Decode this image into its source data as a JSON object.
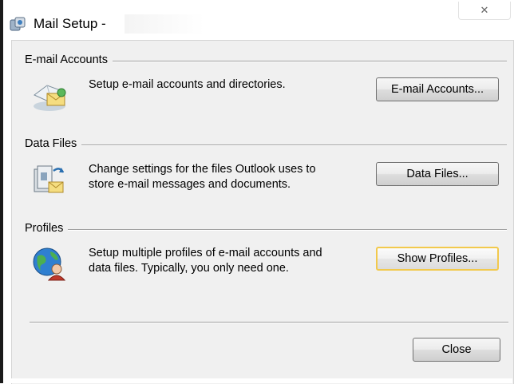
{
  "window": {
    "title": "Mail Setup -",
    "close_glyph": "✕"
  },
  "groups": {
    "email_accounts": {
      "title": "E-mail Accounts",
      "description": "Setup e-mail accounts and directories.",
      "button_label": "E-mail Accounts...",
      "icon": "mail-envelope-icon"
    },
    "data_files": {
      "title": "Data Files",
      "description_line1": "Change settings for the files Outlook uses to",
      "description_line2": "store e-mail messages and documents.",
      "button_label": "Data Files...",
      "icon": "data-files-icon"
    },
    "profiles": {
      "title": "Profiles",
      "description_line1": "Setup multiple profiles of e-mail accounts and",
      "description_line2": "data files. Typically, you only need one.",
      "button_label": "Show Profiles...",
      "icon": "globe-profile-icon"
    }
  },
  "footer": {
    "close_label": "Close"
  },
  "colors": {
    "dialog_background": "#f0f0f0",
    "focus_border": "#f2c94c",
    "button_border": "#707070"
  }
}
